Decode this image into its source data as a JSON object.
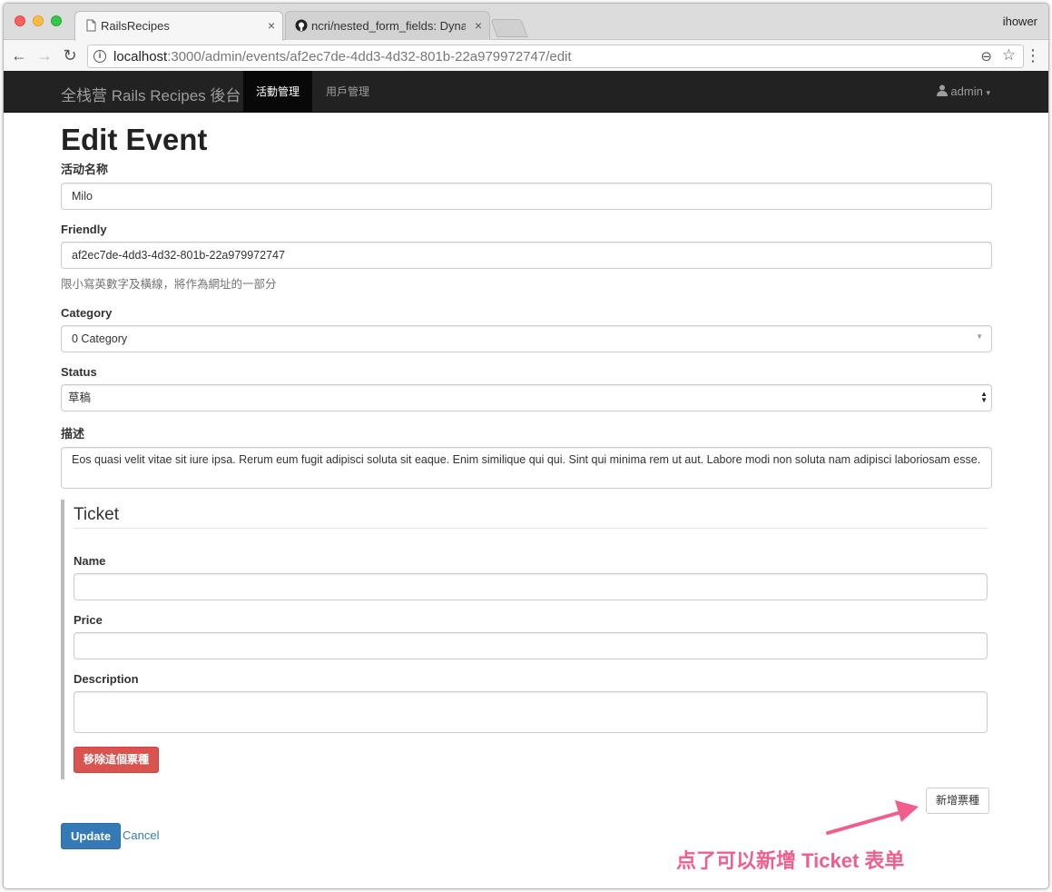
{
  "browser": {
    "tabs": [
      {
        "title": "RailsRecipes",
        "close": "×"
      },
      {
        "title": "ncri/nested_form_fields: Dynamically add and remove nested",
        "close": "×"
      }
    ],
    "profile": "ihower",
    "back": "←",
    "forward": "→",
    "reload": "↻",
    "url_host": "localhost",
    "url_path": ":3000/admin/events/af2ec7de-4dd3-4d32-801b-22a979972747/edit",
    "info": "i",
    "zoom": "⊖",
    "star": "☆",
    "menu": "⋮"
  },
  "navbar": {
    "brand": "全栈营 Rails Recipes 後台",
    "items": [
      "活動管理",
      "用戶管理"
    ],
    "active_index": 0,
    "user_label": "admin",
    "caret": "▾",
    "user_icon": "user-icon"
  },
  "page": {
    "title": "Edit Event",
    "fields": {
      "name_label": "活动名称",
      "name_value": "Milo",
      "friendly_label": "Friendly",
      "friendly_value": "af2ec7de-4dd3-4d32-801b-22a979972747",
      "friendly_help": "限小寫英數字及橫線，將作為網址的一部分",
      "category_label": "Category",
      "category_value": "0 Category",
      "status_label": "Status",
      "status_value": "草稿",
      "description_label": "描述",
      "description_value": "Eos quasi velit vitae sit iure ipsa. Rerum eum fugit adipisci soluta sit eaque. Enim similique qui qui. Sint qui minima rem ut aut. Labore modi non soluta nam adipisci laboriosam esse."
    },
    "ticket": {
      "legend": "Ticket",
      "name_label": "Name",
      "name_value": "",
      "price_label": "Price",
      "price_value": "",
      "description_label": "Description",
      "description_value": "",
      "remove_button": "移除這個票種"
    },
    "add_ticket_button": "新增票種",
    "update_button": "Update",
    "cancel_link": "Cancel"
  },
  "annotation": {
    "text": "点了可以新增 Ticket 表单",
    "color": "#f25e8c"
  },
  "colors": {
    "navbar_bg": "#222222",
    "primary": "#337ab7",
    "danger": "#d9534f"
  }
}
